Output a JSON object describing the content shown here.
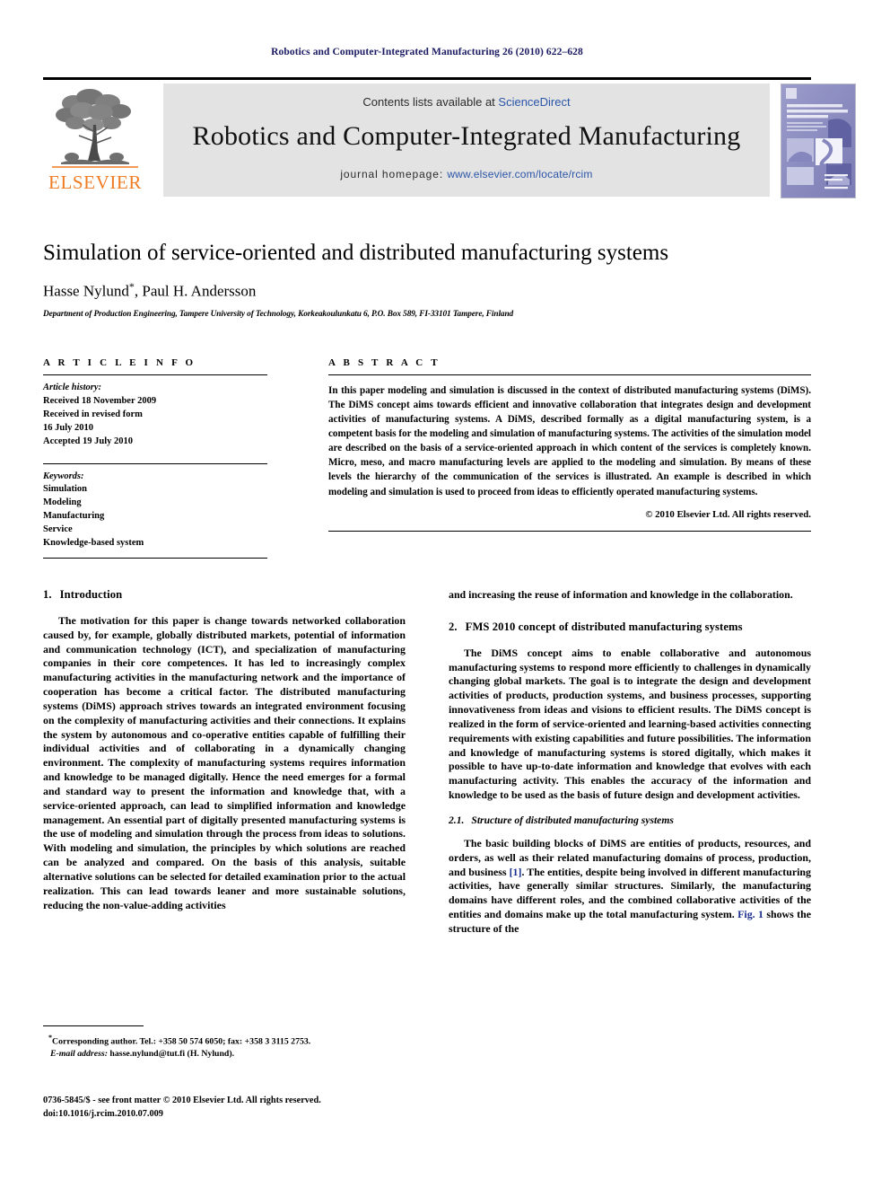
{
  "running_head": "Robotics and Computer-Integrated Manufacturing 26 (2010) 622–628",
  "masthead": {
    "publisher_word": "ELSEVIER",
    "contents_prefix": "Contents lists available at ",
    "contents_link": "ScienceDirect",
    "journal_title": "Robotics and Computer-Integrated Manufacturing",
    "homepage_prefix": "journal homepage: ",
    "homepage_url": "www.elsevier.com/locate/rcim",
    "cover_title_line1": "Robotics and",
    "cover_title_line2": "Computer-Integrated",
    "cover_title_line3": "Manufacturing",
    "cover_sub": "An international journal of manufacturing, process and systems development",
    "link_color": "#2b55a8",
    "brand_color": "#ef7c23",
    "banner_bg": "#e3e3e3"
  },
  "title_block": {
    "title": "Simulation of service-oriented and distributed manufacturing systems",
    "authors": "Hasse Nylund",
    "authors_tail": ", Paul H. Andersson",
    "corresponding_marker": "*",
    "affiliation": "Department of Production Engineering, Tampere University of Technology, Korkeakoulunkatu 6, P.O. Box 589, FI-33101 Tampere, Finland"
  },
  "article_info": {
    "heading": "A R T I C L E  I N F O",
    "history_label": "Article history:",
    "history_lines": [
      "Received 18 November 2009",
      "Received in revised form",
      "16 July 2010",
      "Accepted 19 July 2010"
    ],
    "keywords_label": "Keywords:",
    "keywords": [
      "Simulation",
      "Modeling",
      "Manufacturing",
      "Service",
      "Knowledge-based system"
    ]
  },
  "abstract": {
    "heading": "A B S T R A C T",
    "text": "In this paper modeling and simulation is discussed in the context of distributed manufacturing systems (DiMS). The DiMS concept aims towards efficient and innovative collaboration that integrates design and development activities of manufacturing systems. A DiMS, described formally as a digital manufacturing system, is a competent basis for the modeling and simulation of manufacturing systems. The activities of the simulation model are described on the basis of a service-oriented approach in which content of the services is completely known. Micro, meso, and macro manufacturing levels are applied to the modeling and simulation. By means of these levels the hierarchy of the communication of the services is illustrated. An example is described in which modeling and simulation is used to proceed from ideas to efficiently operated manufacturing systems.",
    "copyright": "© 2010 Elsevier Ltd. All rights reserved."
  },
  "sections": {
    "intro_num": "1.",
    "intro_title": "Introduction",
    "intro_p1": "The motivation for this paper is change towards networked collaboration caused by, for example, globally distributed markets, potential of information and communication technology (ICT), and specialization of manufacturing companies in their core competences. It has led to increasingly complex manufacturing activities in the manufacturing network and the importance of cooperation has become a critical factor. The distributed manufacturing systems (DiMS) approach strives towards an integrated environment focusing on the complexity of manufacturing activities and their connections. It explains the system by autonomous and co-operative entities capable of fulfilling their individual activities and of collaborating in a dynamically changing environment. The complexity of manufacturing systems requires information and knowledge to be managed digitally. Hence the need emerges for a formal and standard way to present the information and knowledge that, with a service-oriented approach, can lead to simplified information and knowledge management. An essential part of digitally presented manufacturing systems is the use of modeling and simulation through the process from ideas to solutions. With modeling and simulation, the principles by which solutions are reached can be analyzed and compared. On the basis of this analysis, suitable alternative solutions can be selected for detailed examination prior to the actual realization. This can lead towards leaner and more sustainable solutions, reducing the non-value-adding activities",
    "intro_p1_cont": "and increasing the reuse of information and knowledge in the collaboration.",
    "sec2_num": "2.",
    "sec2_title": "FMS 2010 concept of distributed manufacturing systems",
    "sec2_p1": "The DiMS concept aims to enable collaborative and autonomous manufacturing systems to respond more efficiently to challenges in dynamically changing global markets. The goal is to integrate the design and development activities of products, production systems, and business processes, supporting innovativeness from ideas and visions to efficient results. The DiMS concept is realized in the form of service-oriented and learning-based activities connecting requirements with existing capabilities and future possibilities. The information and knowledge of manufacturing systems is stored digitally, which makes it possible to have up-to-date information and knowledge that evolves with each manufacturing activity. This enables the accuracy of the information and knowledge to be used as the basis of future design and development activities.",
    "sec21_num": "2.1.",
    "sec21_title": "Structure of distributed manufacturing systems",
    "sec21_p1_a": "The basic building blocks of DiMS are entities of products, resources, and orders, as well as their related manufacturing domains of process, production, and business ",
    "sec21_ref1": "[1]",
    "sec21_p1_b": ". The entities, despite being involved in different manufacturing activities, have generally similar structures. Similarly, the manufacturing domains have different roles, and the combined collaborative activities of the entities and domains make up the total manufacturing system. ",
    "sec21_ref2": "Fig. 1",
    "sec21_p1_c": " shows the structure of the"
  },
  "footnote": {
    "marker": "*",
    "line1": "Corresponding author. Tel.: +358 50 574 6050; fax: +358 3 3115 2753.",
    "email_label": "E-mail address:",
    "email": "hasse.nylund@tut.fi (H. Nylund)."
  },
  "footer": {
    "line1": "0736-5845/$ - see front matter © 2010 Elsevier Ltd. All rights reserved.",
    "line2": "doi:10.1016/j.rcim.2010.07.009"
  }
}
